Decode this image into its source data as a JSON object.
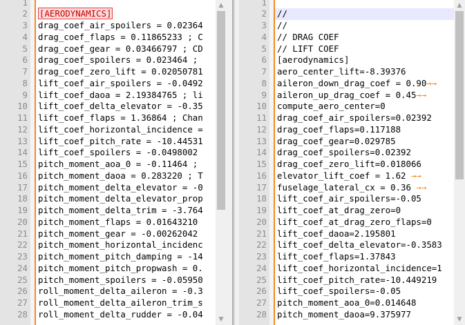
{
  "left_editor": {
    "lines": [
      {
        "n": "1",
        "text": ""
      },
      {
        "n": "2",
        "text": "[AERODYNAMICS]",
        "selected": true
      },
      {
        "n": "3",
        "text": "drag_coef_air_spoilers = 0.02364"
      },
      {
        "n": "4",
        "text": "drag_coef_flaps = 0.11865233 ; C"
      },
      {
        "n": "5",
        "text": "drag_coef_gear = 0.03466797 ; CD"
      },
      {
        "n": "6",
        "text": "drag_coef_spoilers = 0.023464 ;"
      },
      {
        "n": "7",
        "text": "drag_coef_zero_lift = 0.02050781"
      },
      {
        "n": "8",
        "text": "lift_coef_air_spoilers = -0.0492"
      },
      {
        "n": "9",
        "text": "lift_coef_daoa = 2.19384765 ; li"
      },
      {
        "n": "10",
        "text": "lift_coef_delta_elevator = -0.35"
      },
      {
        "n": "11",
        "text": "lift_coef_flaps = 1.36864 ; Chan"
      },
      {
        "n": "12",
        "text": "lift_coef_horizontal_incidence ="
      },
      {
        "n": "13",
        "text": "lift_coef_pitch_rate = -10.44531"
      },
      {
        "n": "14",
        "text": "lift_coef_spoilers = -0.0498002"
      },
      {
        "n": "15",
        "text": "pitch_moment_aoa_0 = -0.11464 ;"
      },
      {
        "n": "16",
        "text": "pitch_moment_daoa = 0.283220 ; T"
      },
      {
        "n": "17",
        "text": "pitch_moment_delta_elevator = -0"
      },
      {
        "n": "18",
        "text": "pitch_moment_delta_elevator_prop"
      },
      {
        "n": "19",
        "text": "pitch_moment_delta_trim = -3.764"
      },
      {
        "n": "20",
        "text": "pitch_moment_flaps = 0.01643210"
      },
      {
        "n": "21",
        "text": "pitch_moment_gear = -0.00262042"
      },
      {
        "n": "22",
        "text": "pitch_moment_horizontal_incidenc"
      },
      {
        "n": "23",
        "text": "pitch_moment_pitch_damping = -14"
      },
      {
        "n": "24",
        "text": "pitch_moment_pitch_propwash = 0."
      },
      {
        "n": "25",
        "text": "pitch_moment_spoilers = -0.05950"
      },
      {
        "n": "26",
        "text": "roll_moment_delta_aileron = -0.3"
      },
      {
        "n": "27",
        "text": "roll_moment_delta_aileron_trim_s"
      },
      {
        "n": "28",
        "text": "roll_moment_delta_rudder = -0.04"
      }
    ]
  },
  "right_editor": {
    "lines": [
      {
        "n": "1",
        "text": ""
      },
      {
        "n": "2",
        "text": "//"
      },
      {
        "n": "3",
        "text": "//"
      },
      {
        "n": "4",
        "text": "// DRAG COEF"
      },
      {
        "n": "5",
        "text": "// LIFT COEF"
      },
      {
        "n": "6",
        "text": "[aerodynamics]"
      },
      {
        "n": "7",
        "text": "aero_center_lift=-8.39376"
      },
      {
        "n": "8",
        "text": "aileron_down_drag_coef = 0.90",
        "tab": true
      },
      {
        "n": "9",
        "text": "aileron_up_drag_coef = 0.45",
        "tab": true
      },
      {
        "n": "10",
        "text": "compute_aero_center=0"
      },
      {
        "n": "11",
        "text": "drag_coef_air_spoilers=0.02392"
      },
      {
        "n": "12",
        "text": "drag_coef_flaps=0.117188"
      },
      {
        "n": "13",
        "text": "drag_coef_gear=0.029785"
      },
      {
        "n": "14",
        "text": "drag_coef_spoilers=0.02392"
      },
      {
        "n": "15",
        "text": "drag_coef_zero_lift=0.018066"
      },
      {
        "n": "16",
        "text": "elevator_lift_coef = 1.62 ",
        "tab": true
      },
      {
        "n": "17",
        "text": "fuselage_lateral_cx = 0.36 ",
        "tab": true
      },
      {
        "n": "18",
        "text": "lift_coef_air_spoilers=-0.05"
      },
      {
        "n": "19",
        "text": "lift_coef_at_drag_zero=0"
      },
      {
        "n": "20",
        "text": "lift_coef_at_drag_zero_flaps=0"
      },
      {
        "n": "21",
        "text": "lift_coef_daoa=2.195801"
      },
      {
        "n": "22",
        "text": "lift_coef_delta_elevator=-0.3583"
      },
      {
        "n": "23",
        "text": "lift_coef_flaps=1.37843"
      },
      {
        "n": "24",
        "text": "lift_coef_horizontal_incidence=1"
      },
      {
        "n": "25",
        "text": "lift_coef_pitch_rate=-10.449219"
      },
      {
        "n": "26",
        "text": "lift_coef_spoilers=-0.05"
      },
      {
        "n": "27",
        "text": "pitch_moment_aoa_0=0.014648"
      },
      {
        "n": "28",
        "text": "pitch_moment_daoa=9.375977"
      }
    ]
  },
  "icons": {
    "scroll_up": "up-arrow-icon",
    "scroll_down": "down-arrow-icon",
    "tab_arrow": "tab-arrow-icon"
  },
  "colors": {
    "change_bar": "#f08a24",
    "current_line": "#e8e8ff",
    "selection_border": "#e04040",
    "selection_text": "#c40000"
  }
}
